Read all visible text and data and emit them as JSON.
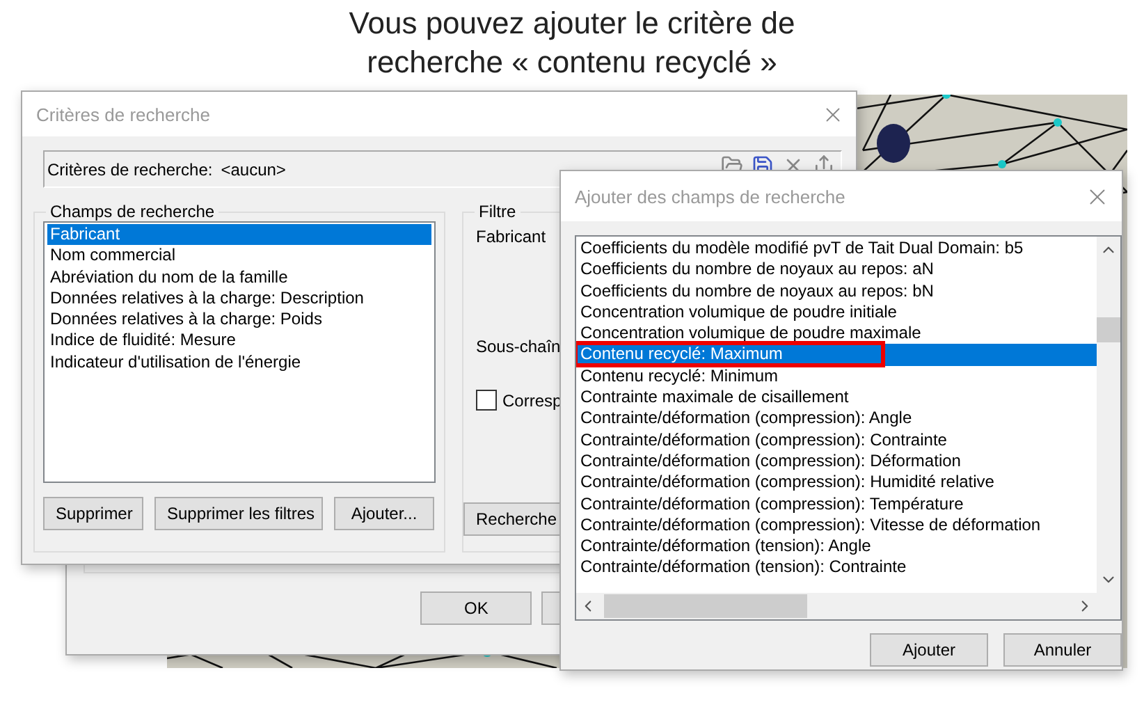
{
  "caption": "Vous pouvez ajouter le critère de recherche « contenu recyclé »",
  "back_window": {
    "buttons": [
      {
        "label": "OK"
      }
    ]
  },
  "main_dialog": {
    "title": "Critères de recherche",
    "criteria": {
      "label": "Critères de recherche:",
      "value": "<aucun>"
    },
    "fields_group": {
      "title": "Champs de recherche",
      "items": [
        {
          "label": "Fabricant",
          "selected": true
        },
        {
          "label": "Nom commercial",
          "selected": false
        },
        {
          "label": "Abréviation du nom de la famille",
          "selected": false
        },
        {
          "label": "Données relatives à la charge: Description",
          "selected": false
        },
        {
          "label": "Données relatives à la charge: Poids",
          "selected": false
        },
        {
          "label": "Indice de fluidité: Mesure",
          "selected": false
        },
        {
          "label": "Indicateur d'utilisation de l'énergie",
          "selected": false
        }
      ],
      "buttons": [
        "Supprimer",
        "Supprimer les filtres",
        "Ajouter..."
      ]
    },
    "filter_group": {
      "title": "Filtre",
      "field_label": "Fabricant",
      "substring_label": "Sous-chaîn",
      "checkbox": {
        "label": "Corresp",
        "checked": false
      },
      "button": "Recherche"
    }
  },
  "add_dialog": {
    "title": "Ajouter des champs de recherche",
    "items": [
      {
        "label": "Coefficients du modèle modifié pvT de Tait Dual Domain: b5",
        "selected": false,
        "highlighted": false
      },
      {
        "label": "Coefficients du nombre de noyaux au repos: aN",
        "selected": false,
        "highlighted": false
      },
      {
        "label": "Coefficients du nombre de noyaux au repos: bN",
        "selected": false,
        "highlighted": false
      },
      {
        "label": "Concentration volumique de poudre initiale",
        "selected": false,
        "highlighted": false
      },
      {
        "label": "Concentration volumique de poudre maximale",
        "selected": false,
        "highlighted": false
      },
      {
        "label": "Contenu recyclé: Maximum",
        "selected": true,
        "highlighted": true
      },
      {
        "label": "Contenu recyclé: Minimum",
        "selected": false,
        "highlighted": false
      },
      {
        "label": "Contrainte maximale de cisaillement",
        "selected": false,
        "highlighted": false
      },
      {
        "label": "Contrainte/déformation (compression): Angle",
        "selected": false,
        "highlighted": false
      },
      {
        "label": "Contrainte/déformation (compression): Contrainte",
        "selected": false,
        "highlighted": false
      },
      {
        "label": "Contrainte/déformation (compression): Déformation",
        "selected": false,
        "highlighted": false
      },
      {
        "label": "Contrainte/déformation (compression): Humidité relative",
        "selected": false,
        "highlighted": false
      },
      {
        "label": "Contrainte/déformation (compression): Température",
        "selected": false,
        "highlighted": false
      },
      {
        "label": "Contrainte/déformation (compression): Vitesse de déformation",
        "selected": false,
        "highlighted": false
      },
      {
        "label": "Contrainte/déformation (tension): Angle",
        "selected": false,
        "highlighted": false
      },
      {
        "label": "Contrainte/déformation (tension): Contrainte",
        "selected": false,
        "highlighted": false
      }
    ],
    "buttons": [
      "Ajouter",
      "Annuler"
    ]
  }
}
